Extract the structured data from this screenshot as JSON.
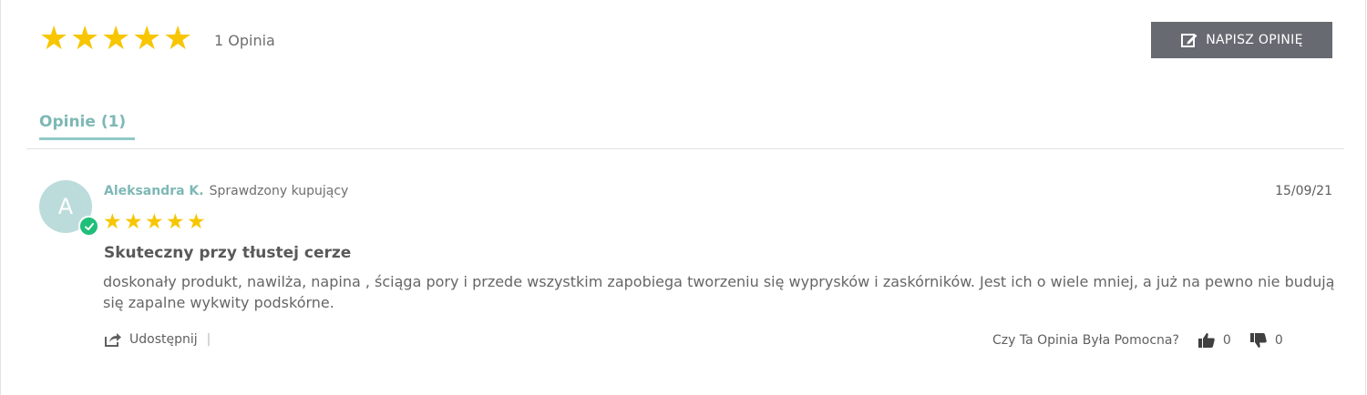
{
  "summary": {
    "rating_value": 5,
    "rating_max": 5,
    "stars": [
      "★",
      "★",
      "★",
      "★",
      "★"
    ],
    "count_label": "1 Opinia"
  },
  "write_button": {
    "label": "NAPISZ OPINIĘ",
    "icon": "edit-icon"
  },
  "tabs": [
    {
      "label": "Opinie (1)",
      "active": true
    }
  ],
  "review": {
    "avatar_initial": "A",
    "author": "Aleksandra K.",
    "verified_label": "Sprawdzony kupujący",
    "verified_icon": "check-icon",
    "date": "15/09/21",
    "rating_value": 5,
    "stars": [
      "★",
      "★",
      "★",
      "★",
      "★"
    ],
    "title": "Skuteczny przy tłustej cerze",
    "body": "doskonały produkt, nawilża, napina , ściąga pory i przede wszystkim zapobiega tworzeniu się wyprysków i zaskórników. Jest ich o wiele mniej, a już na pewno nie budują się zapalne wykwity podskórne.",
    "share_label": "Udostępnij",
    "share_separator": "|",
    "helpful_question": "Czy Ta Opinia Była Pomocna?",
    "upvotes": "0",
    "downvotes": "0"
  },
  "colors": {
    "star": "#f7c600",
    "accent": "#7db8b5",
    "button_bg": "#686a72",
    "avatar_bg": "#bcdcdb",
    "verified_badge": "#1fbf7a",
    "text": "#666666"
  }
}
